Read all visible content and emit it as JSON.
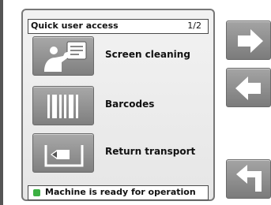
{
  "panel": {
    "title": "Quick user access",
    "page_indicator": "1/2"
  },
  "menu": {
    "items": [
      {
        "label": "Screen cleaning",
        "icon": "screen-cleaning-icon"
      },
      {
        "label": "Barcodes",
        "icon": "barcode-icon"
      },
      {
        "label": "Return transport",
        "icon": "return-transport-icon"
      }
    ]
  },
  "status": {
    "text": "Machine is ready for operation",
    "color": "#3cb043"
  },
  "nav": {
    "next_icon": "arrow-right-icon",
    "previous_icon": "arrow-left-icon",
    "back_icon": "return-arrow-icon"
  },
  "colors": {
    "button_gray": "#8f8f8f",
    "glyph_white": "#ffffff"
  }
}
